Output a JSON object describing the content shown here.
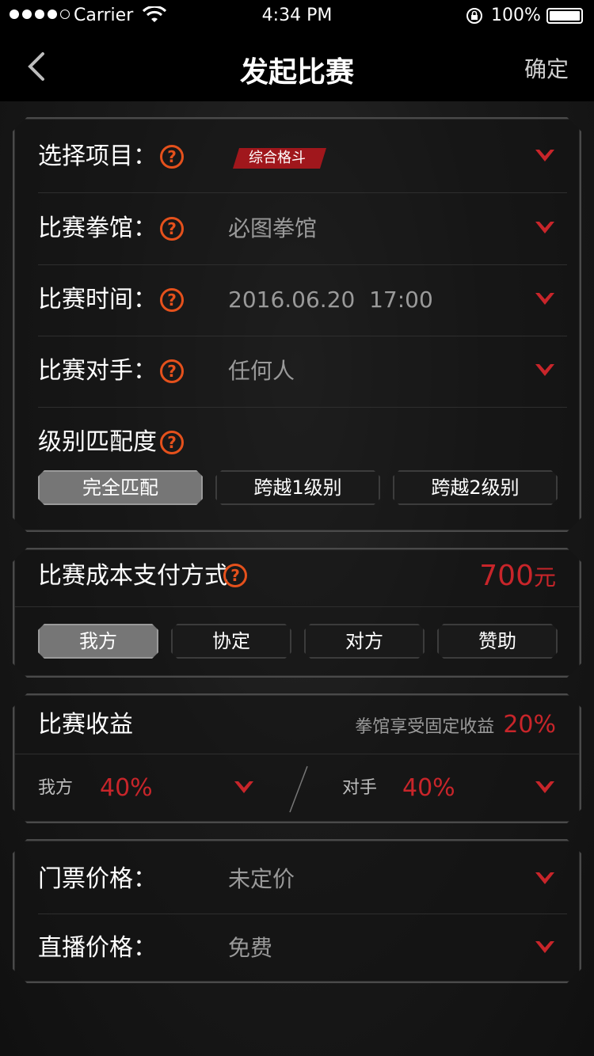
{
  "status_bar": {
    "carrier": "Carrier",
    "time": "4:34 PM",
    "battery": "100%"
  },
  "nav": {
    "title": "发起比赛",
    "confirm": "确定"
  },
  "match_form": {
    "project_label": "选择项目：",
    "project_tag": "综合格斗",
    "gym_label": "比赛拳馆：",
    "gym_value": "必图拳馆",
    "time_label": "比赛时间：",
    "time_value": "2016.06.20  17:00",
    "opponent_label": "比赛对手：",
    "opponent_value": "任何人",
    "level_label": "级别匹配度",
    "level_options": [
      "完全匹配",
      "跨越1级别",
      "跨越2级别"
    ]
  },
  "cost": {
    "label": "比赛成本支付方式",
    "amount": "700",
    "unit": "元",
    "options": [
      "我方",
      "协定",
      "对方",
      "赞助"
    ]
  },
  "revenue": {
    "label": "比赛收益",
    "gym_label": "拳馆享受固定收益",
    "gym_value": "20%",
    "ours_label": "我方",
    "ours_value": "40%",
    "theirs_label": "对手",
    "theirs_value": "40%"
  },
  "prices": {
    "ticket_label": "门票价格：",
    "ticket_value": "未定价",
    "live_label": "直播价格：",
    "live_value": "免费"
  },
  "colors": {
    "accent_red": "#c8252a",
    "help_orange": "#e5511c"
  }
}
